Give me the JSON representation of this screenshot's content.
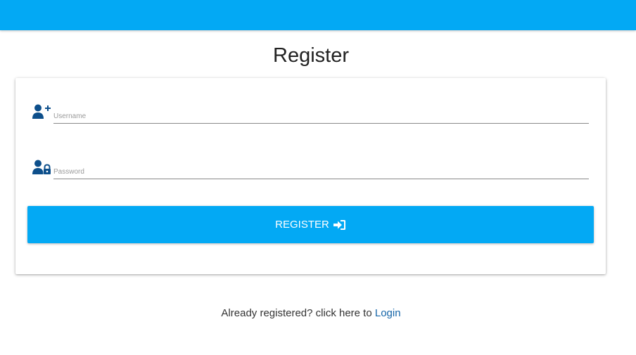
{
  "header": {
    "bar_color": "#03a9f4"
  },
  "page": {
    "title": "Register"
  },
  "form": {
    "username": {
      "placeholder": "Username",
      "value": "",
      "icon": "user-plus-icon"
    },
    "password": {
      "placeholder": "Password",
      "value": "",
      "icon": "user-lock-icon"
    },
    "submit": {
      "label": "REGISTER",
      "icon": "sign-in-icon",
      "color": "#03a9f4"
    }
  },
  "footer": {
    "prompt": "Already registered? click here to",
    "login_link": "Login",
    "link_color": "#1565a8"
  },
  "colors": {
    "icon": "#0d4f8b"
  }
}
